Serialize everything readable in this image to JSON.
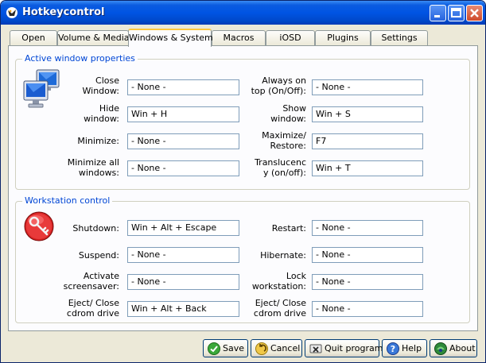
{
  "window": {
    "title": "Hotkeycontrol"
  },
  "tabs": [
    {
      "label": "Open"
    },
    {
      "label": "Volume & Media"
    },
    {
      "label": "Windows & System"
    },
    {
      "label": "Macros"
    },
    {
      "label": "iOSD"
    },
    {
      "label": "Plugins"
    },
    {
      "label": "Settings"
    }
  ],
  "active_window_group": {
    "title": "Active window properties",
    "left": [
      {
        "label": "Close\nWindow:",
        "value": "- None -"
      },
      {
        "label": "Hide\nwindow:",
        "value": "Win + H"
      },
      {
        "label": "Minimize:",
        "value": "- None -"
      },
      {
        "label": "Minimize all\nwindows:",
        "value": "- None -"
      }
    ],
    "right": [
      {
        "label": "Always on\ntop (On/Off):",
        "value": "- None -"
      },
      {
        "label": "Show\nwindow:",
        "value": "Win + S"
      },
      {
        "label": "Maximize/\nRestore:",
        "value": "F7"
      },
      {
        "label": "Translucenc\ny (on/off):",
        "value": "Win + T"
      }
    ]
  },
  "workstation_group": {
    "title": "Workstation control",
    "left": [
      {
        "label": "Shutdown:",
        "value": "Win + Alt + Escape"
      },
      {
        "label": "Suspend:",
        "value": "- None -"
      },
      {
        "label": "Activate\nscreensaver:",
        "value": "- None -"
      },
      {
        "label": "Eject/ Close\ncdrom drive",
        "value": "Win + Alt + Back"
      }
    ],
    "right": [
      {
        "label": "Restart:",
        "value": "- None -"
      },
      {
        "label": "Hibernate:",
        "value": "- None -"
      },
      {
        "label": "Lock\nworkstation:",
        "value": "- None -"
      },
      {
        "label": "Eject/ Close\ncdrom drive",
        "value": "- None -"
      }
    ]
  },
  "buttons": {
    "save": "Save",
    "cancel": "Cancel",
    "quit": "Quit program",
    "help": "Help",
    "about": "About"
  }
}
